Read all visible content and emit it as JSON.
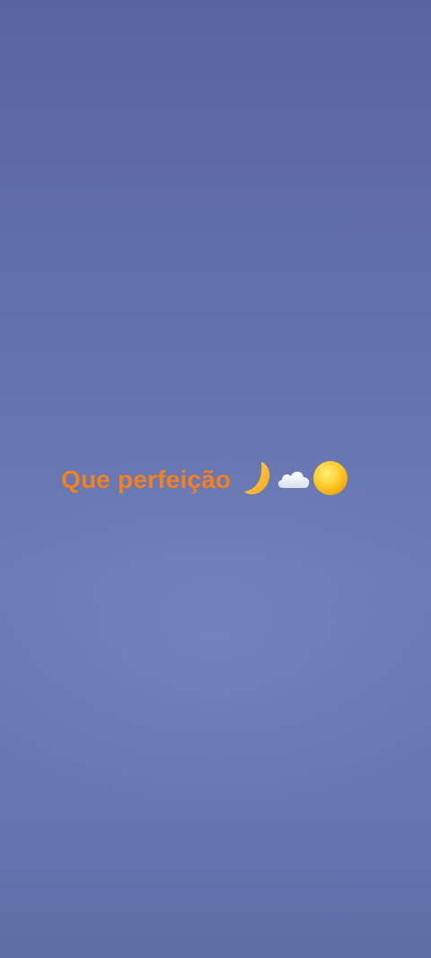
{
  "caption": {
    "text": "Que perfeição",
    "color": "#f5801f",
    "emojis": [
      "crescent-moon-icon",
      "cloud-icon",
      "sun-icon"
    ]
  },
  "background": {
    "top_color": "#5a63a0",
    "bottom_color": "#6a7cb6"
  }
}
